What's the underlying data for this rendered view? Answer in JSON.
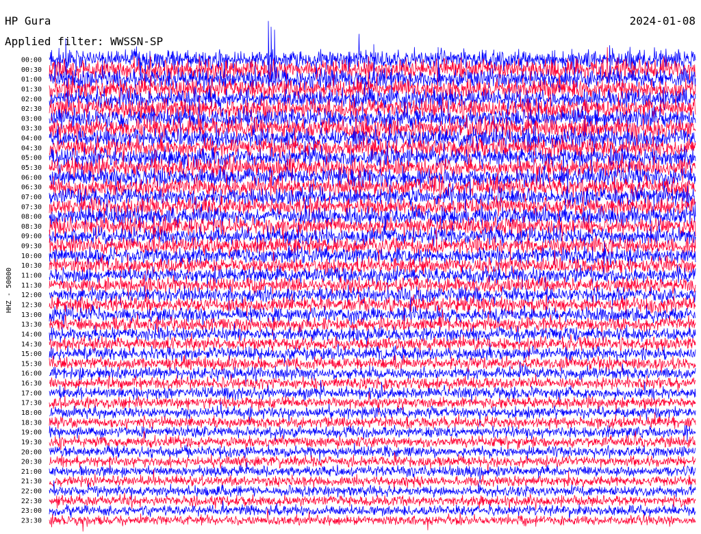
{
  "header": {
    "station": "HP Gura",
    "date": "2024-01-08",
    "filter": "Applied filter: WWSSN-SP"
  },
  "chart_data": {
    "type": "line",
    "subtype": "helicorder",
    "title": "HP Gura",
    "date": "2024-01-08",
    "ylabel": "HHZ - 50000",
    "row_labels": [
      "00:00",
      "00:30",
      "01:00",
      "01:30",
      "02:00",
      "02:30",
      "03:00",
      "03:30",
      "04:00",
      "04:30",
      "05:00",
      "05:30",
      "06:00",
      "06:30",
      "07:00",
      "07:30",
      "08:00",
      "08:30",
      "09:00",
      "09:30",
      "10:00",
      "10:30",
      "11:00",
      "11:30",
      "12:00",
      "12:30",
      "13:00",
      "13:30",
      "14:00",
      "14:30",
      "15:00",
      "15:30",
      "16:00",
      "16:30",
      "17:00",
      "17:30",
      "18:00",
      "18:30",
      "19:00",
      "19:30",
      "20:00",
      "20:30",
      "21:00",
      "21:30",
      "22:00",
      "22:30",
      "23:00",
      "23:30"
    ],
    "row_minutes": 30,
    "trace_colors": [
      "#0000ff",
      "#ff0033"
    ],
    "series_amplitude": [
      1.0,
      1.0,
      1.0,
      1.0,
      1.0,
      1.0,
      1.0,
      1.0,
      0.98,
      0.98,
      0.97,
      0.97,
      0.96,
      0.95,
      0.94,
      0.93,
      0.92,
      0.9,
      0.88,
      0.86,
      0.84,
      0.82,
      0.8,
      0.78,
      0.76,
      0.74,
      0.72,
      0.7,
      0.68,
      0.66,
      0.64,
      0.62,
      0.6,
      0.59,
      0.58,
      0.57,
      0.56,
      0.55,
      0.55,
      0.54,
      0.54,
      0.53,
      0.53,
      0.52,
      0.52,
      0.52,
      0.52,
      0.52
    ],
    "grid": false,
    "legend": "none"
  }
}
